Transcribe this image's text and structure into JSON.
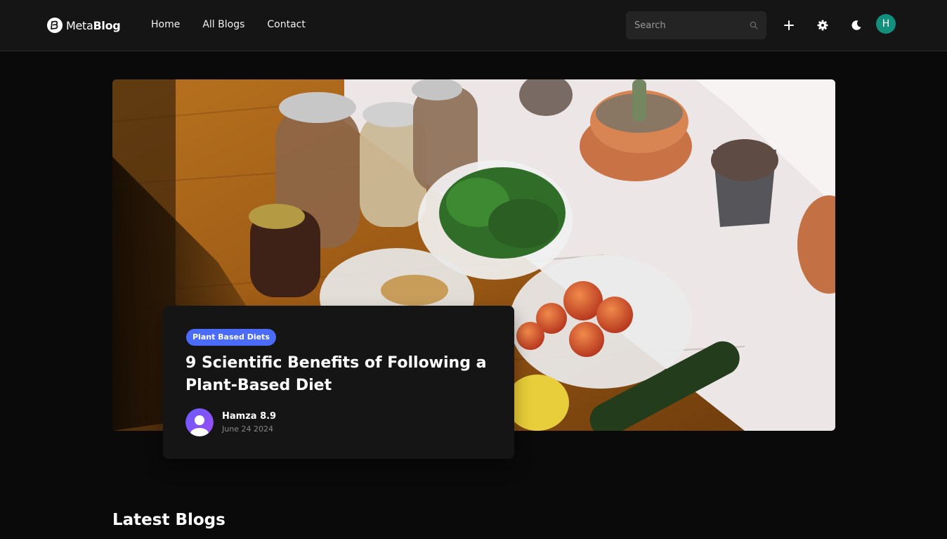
{
  "brand": {
    "name_light": "Meta",
    "name_bold": "Blog"
  },
  "nav": {
    "items": [
      {
        "label": "Home"
      },
      {
        "label": "All Blogs"
      },
      {
        "label": "Contact"
      }
    ]
  },
  "search": {
    "placeholder": "Search",
    "value": ""
  },
  "header_actions": {
    "add_icon": "plus-icon",
    "settings_icon": "gear-icon",
    "theme_icon": "moon-icon",
    "user_initial": "H"
  },
  "featured_post": {
    "category": "Plant Based Diets",
    "title": "9 Scientific Benefits of Following a Plant-Based Diet",
    "author": "Hamza 8.9",
    "date": "June 24 2024",
    "image": "photo of jars of legumes, cashews, peaches, leafy greens, cucumber and potted cacti on a wooden counter"
  },
  "latest_section": {
    "title": "Latest Blogs"
  },
  "colors": {
    "background": "#0a0a0a",
    "navbar": "#151515",
    "card": "#151515",
    "accent": "#4b6bfb",
    "user_avatar": "#13907d"
  }
}
